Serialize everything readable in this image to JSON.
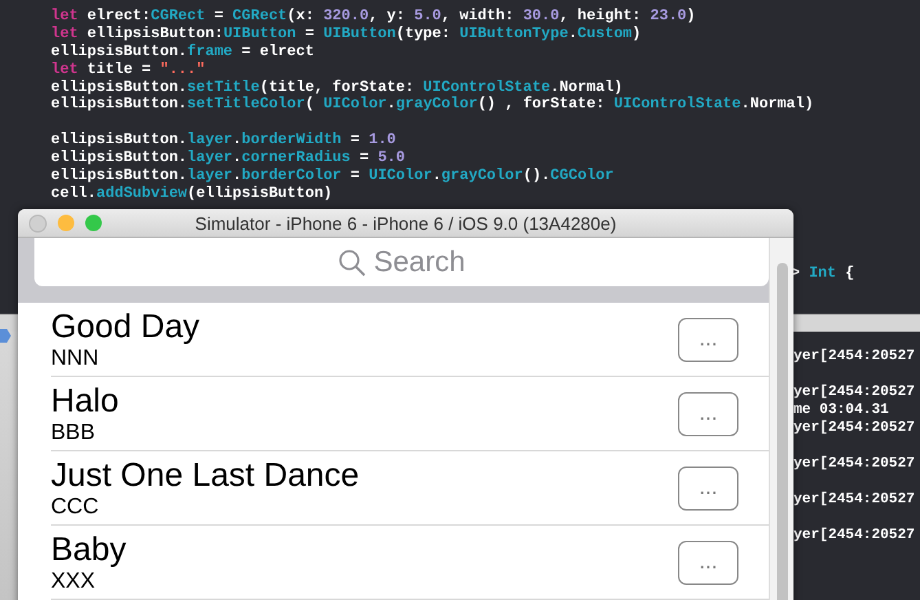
{
  "editor": {
    "code_blocks": [
      [
        [
          {
            "text": "let",
            "kind": "keyword"
          },
          {
            "text": " elrect:",
            "kind": "plain"
          },
          {
            "text": "CGRect",
            "kind": "type"
          },
          {
            "text": " = ",
            "kind": "plain"
          },
          {
            "text": "CGRect",
            "kind": "type"
          },
          {
            "text": "(x: ",
            "kind": "plain"
          },
          {
            "text": "320.0",
            "kind": "number"
          },
          {
            "text": ", y: ",
            "kind": "plain"
          },
          {
            "text": "5.0",
            "kind": "number"
          },
          {
            "text": ", width: ",
            "kind": "plain"
          },
          {
            "text": "30.0",
            "kind": "number"
          },
          {
            "text": ", height: ",
            "kind": "plain"
          },
          {
            "text": "23.0",
            "kind": "number"
          },
          {
            "text": ")",
            "kind": "plain"
          }
        ],
        [
          {
            "text": "let",
            "kind": "keyword"
          },
          {
            "text": " ellipsisButton:",
            "kind": "plain"
          },
          {
            "text": "UIButton",
            "kind": "type"
          },
          {
            "text": " = ",
            "kind": "plain"
          },
          {
            "text": "UIButton",
            "kind": "type"
          },
          {
            "text": "(type: ",
            "kind": "plain"
          },
          {
            "text": "UIButtonType",
            "kind": "type"
          },
          {
            "text": ".",
            "kind": "plain"
          },
          {
            "text": "Custom",
            "kind": "type"
          },
          {
            "text": ")",
            "kind": "plain"
          }
        ],
        [
          {
            "text": "ellipsisButton.",
            "kind": "plain"
          },
          {
            "text": "frame",
            "kind": "type"
          },
          {
            "text": " = elrect",
            "kind": "plain"
          }
        ],
        [
          {
            "text": "let",
            "kind": "keyword"
          },
          {
            "text": " title = ",
            "kind": "plain"
          },
          {
            "text": "\"...\"",
            "kind": "string"
          }
        ],
        [
          {
            "text": "ellipsisButton.",
            "kind": "plain"
          },
          {
            "text": "setTitle",
            "kind": "type"
          },
          {
            "text": "(title, forState: ",
            "kind": "plain"
          },
          {
            "text": "UIControlState",
            "kind": "type"
          },
          {
            "text": ".Normal)",
            "kind": "plain"
          }
        ],
        [
          {
            "text": "ellipsisButton.",
            "kind": "plain"
          },
          {
            "text": "setTitleColor",
            "kind": "type"
          },
          {
            "text": "( ",
            "kind": "plain"
          },
          {
            "text": "UIColor",
            "kind": "type"
          },
          {
            "text": ".",
            "kind": "plain"
          },
          {
            "text": "grayColor",
            "kind": "type"
          },
          {
            "text": "() , forState: ",
            "kind": "plain"
          },
          {
            "text": "UIControlState",
            "kind": "type"
          },
          {
            "text": ".Normal)",
            "kind": "plain"
          }
        ]
      ],
      [
        [
          {
            "text": "ellipsisButton.",
            "kind": "plain"
          },
          {
            "text": "layer",
            "kind": "type"
          },
          {
            "text": ".",
            "kind": "plain"
          },
          {
            "text": "borderWidth",
            "kind": "type"
          },
          {
            "text": " = ",
            "kind": "plain"
          },
          {
            "text": "1.0",
            "kind": "number"
          }
        ],
        [
          {
            "text": "ellipsisButton.",
            "kind": "plain"
          },
          {
            "text": "layer",
            "kind": "type"
          },
          {
            "text": ".",
            "kind": "plain"
          },
          {
            "text": "cornerRadius",
            "kind": "type"
          },
          {
            "text": " = ",
            "kind": "plain"
          },
          {
            "text": "5.0",
            "kind": "number"
          }
        ],
        [
          {
            "text": "ellipsisButton.",
            "kind": "plain"
          },
          {
            "text": "layer",
            "kind": "type"
          },
          {
            "text": ".",
            "kind": "plain"
          },
          {
            "text": "borderColor",
            "kind": "type"
          },
          {
            "text": " = ",
            "kind": "plain"
          },
          {
            "text": "UIColor",
            "kind": "type"
          },
          {
            "text": ".",
            "kind": "plain"
          },
          {
            "text": "grayColor",
            "kind": "type"
          },
          {
            "text": "().",
            "kind": "plain"
          },
          {
            "text": "CGColor",
            "kind": "type"
          }
        ],
        [
          {
            "text": "cell.",
            "kind": "plain"
          },
          {
            "text": "addSubview",
            "kind": "type"
          },
          {
            "text": "(ellipsisButton)",
            "kind": "plain"
          }
        ]
      ]
    ],
    "partial_line": [
      {
        "text": "> ",
        "kind": "plain"
      },
      {
        "text": "Int",
        "kind": "type"
      },
      {
        "text": " {",
        "kind": "plain"
      }
    ]
  },
  "console": {
    "groups": [
      [
        "yer[2454:20527"
      ],
      [
        "yer[2454:20527",
        "me 03:04.31",
        "yer[2454:20527"
      ],
      [
        "yer[2454:20527"
      ],
      [
        "yer[2454:20527"
      ],
      [
        "yer[2454:20527"
      ]
    ]
  },
  "simulator": {
    "window": {
      "title": "Simulator - iPhone 6 - iPhone 6 / iOS 9.0 (13A4280e)"
    },
    "search": {
      "placeholder": "Search"
    },
    "rows": [
      {
        "title": "Good Day",
        "subtitle": "NNN",
        "button": "..."
      },
      {
        "title": "Halo",
        "subtitle": "BBB",
        "button": "..."
      },
      {
        "title": "Just One Last Dance",
        "subtitle": "CCC",
        "button": "..."
      },
      {
        "title": "Baby",
        "subtitle": "XXX",
        "button": "..."
      }
    ]
  }
}
